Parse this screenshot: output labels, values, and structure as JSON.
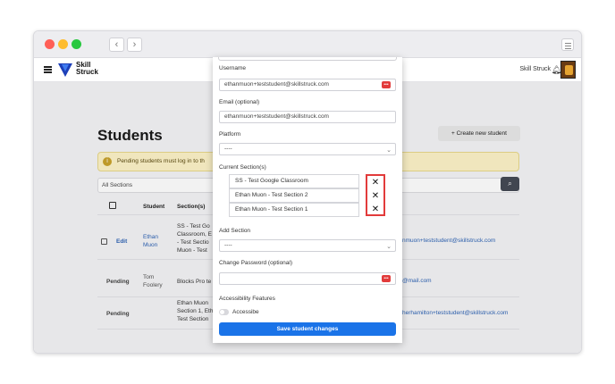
{
  "browser": {
    "traffic_colors": [
      "#ff5f57",
      "#febc2e",
      "#28c840"
    ],
    "back_icon": "chevron-left-icon",
    "forward_icon": "chevron-right-icon"
  },
  "app": {
    "logo_line1": "Skill",
    "logo_line2": "Struck",
    "account_name": "Skill Struck"
  },
  "page": {
    "title": "Students",
    "create_button": "+ Create new student",
    "alert_text": "Pending students must log in to th",
    "filter_value": "All Sections",
    "columns": [
      "Student",
      "Section(s)"
    ],
    "rows": [
      {
        "status": "Edit",
        "name_line1": "Ethan",
        "name_line2": "Muon",
        "sections": [
          "SS - Test Go",
          "Classroom, E",
          "- Test Sectio",
          "Muon - Test"
        ],
        "email": "nmuon+teststudent@skillstruck.com"
      },
      {
        "status": "Pending",
        "name_line1": "Tom",
        "name_line2": "Foolery",
        "sections": [
          "Blocks Pro te"
        ],
        "email": "@mail.com"
      },
      {
        "status": "Pending",
        "name_line1": "",
        "name_line2": "",
        "sections": [
          "Ethan Muon",
          "Section 1, Eth",
          "Test Section"
        ],
        "email": "herhamilton+teststudent@skillstruck.com"
      }
    ]
  },
  "modal": {
    "username_label": "Username",
    "username_value": "ethanmuon+teststudent@skillstruck.com",
    "email_label": "Email (optional)",
    "email_value": "ethanmuon+teststudent@skillstruck.com",
    "platform_label": "Platform",
    "platform_value": "----",
    "current_sections_label": "Current Section(s)",
    "current_sections": [
      "SS - Test Google Classroom",
      "Ethan Muon - Test Section 2",
      "Ethan Muon - Test Section 1"
    ],
    "remove_glyph": "✕",
    "add_section_label": "Add Section",
    "add_section_value": "----",
    "change_password_label": "Change Password (optional)",
    "change_password_value": "",
    "accessibility_label": "Accessibility Features",
    "toggle_label": "Accessibe",
    "save_button": "Save student changes"
  },
  "colors": {
    "primary": "#1a73e8",
    "highlight_red": "#e23b3b",
    "alert_bg": "#fdf3c8"
  }
}
